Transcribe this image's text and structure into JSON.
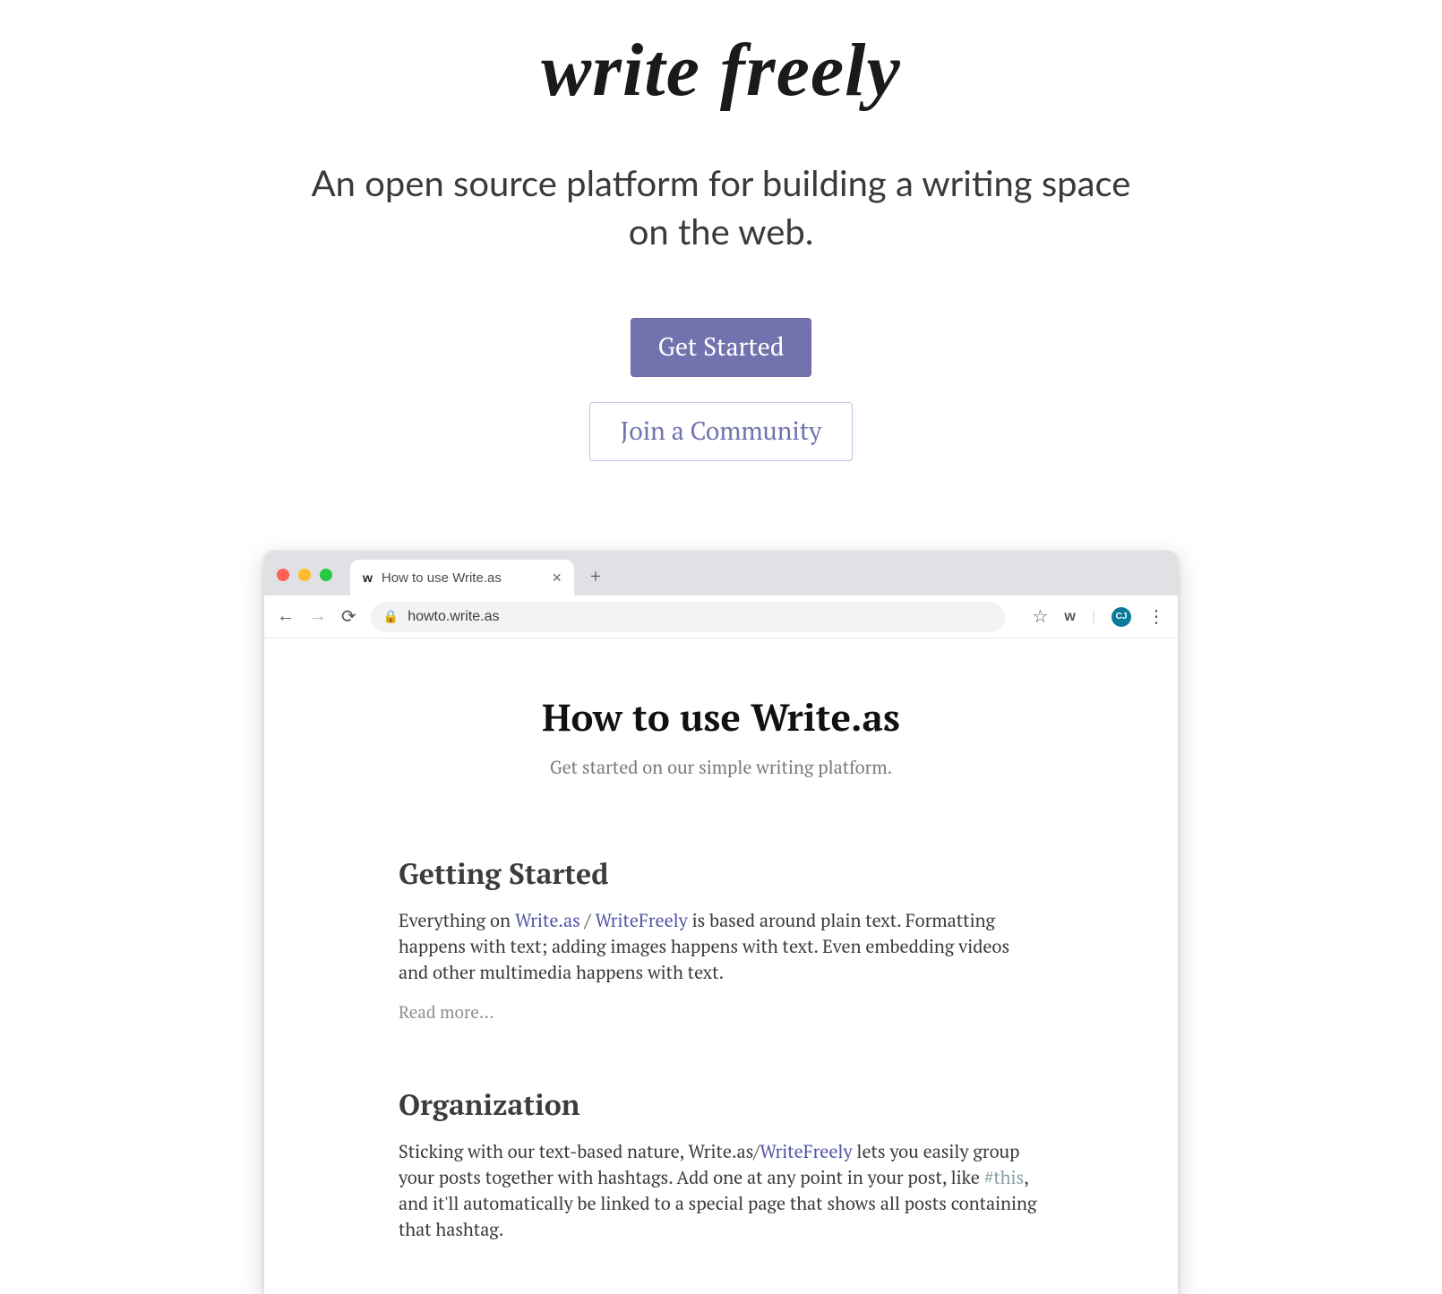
{
  "hero": {
    "logo": "write freely",
    "tagline": "An open source platform for building a writing space on the web.",
    "cta_primary": "Get Started",
    "cta_secondary": "Join a Community"
  },
  "browser": {
    "tab_title": "How to use Write.as",
    "tab_favicon": "w",
    "url": "howto.write.as",
    "right_letter": "w",
    "profile_initials": "CJ"
  },
  "screenshot_page": {
    "title": "How to use Write.as",
    "subtitle": "Get started on our simple writing platform.",
    "posts": [
      {
        "heading": "Getting Started",
        "body_prefix": "Everything on ",
        "link1": "Write.as",
        "sep": " / ",
        "link2": "WriteFreely",
        "body_suffix": " is based around plain text. Formatting happens with text; adding images happens with text. Even embedding videos and other multimedia happens with text.",
        "readmore": "Read more..."
      },
      {
        "heading": "Organization",
        "body_prefix": "Sticking with our text-based nature, Write.as/",
        "link1": "WriteFreely",
        "body_mid": " lets you easily group your posts together with hashtags. Add one at any point in your post, like ",
        "hash": "#this",
        "body_suffix": ", and it'll automatically be linked to a special page that shows all posts containing that hashtag."
      }
    ]
  }
}
